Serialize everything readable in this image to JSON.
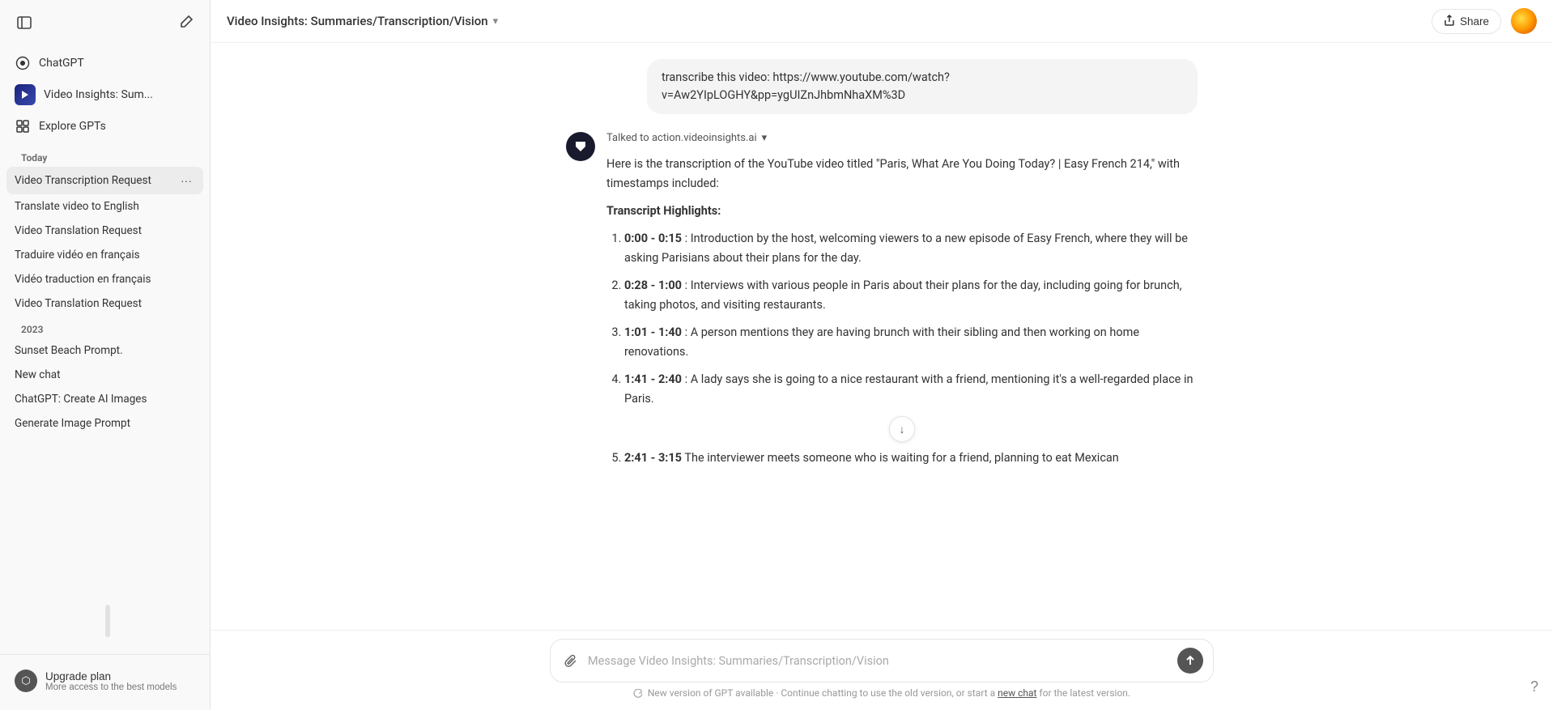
{
  "sidebar": {
    "toggle_label": "Toggle sidebar",
    "new_chat_label": "New chat",
    "nav_items": [
      {
        "id": "chatgpt",
        "label": "ChatGPT",
        "icon": "sparkle"
      },
      {
        "id": "video-insights",
        "label": "Video Insights: Sum...",
        "icon": "vi"
      },
      {
        "id": "explore-gpts",
        "label": "Explore GPTs",
        "icon": "grid"
      }
    ],
    "section_today": "Today",
    "history_today": [
      {
        "id": "video-transcription",
        "label": "Video Transcription Request",
        "active": true
      },
      {
        "id": "translate-video",
        "label": "Translate video to English"
      },
      {
        "id": "video-translation-1",
        "label": "Video Translation Request"
      },
      {
        "id": "traduire-video",
        "label": "Traduire vidéo en français"
      },
      {
        "id": "video-traduction",
        "label": "Vidéo traduction en français"
      },
      {
        "id": "video-translation-2",
        "label": "Video Translation Request"
      }
    ],
    "section_2023": "2023",
    "history_2023": [
      {
        "id": "sunset-beach",
        "label": "Sunset Beach Prompt."
      },
      {
        "id": "new-chat",
        "label": "New chat"
      },
      {
        "id": "chatgpt-ai-images",
        "label": "ChatGPT: Create AI Images"
      },
      {
        "id": "generate-image",
        "label": "Generate Image Prompt"
      }
    ],
    "upgrade": {
      "label": "Upgrade plan",
      "sublabel": "More access to the best models"
    }
  },
  "header": {
    "title": "Video Insights: Summaries/Transcription/Vision",
    "share_label": "Share",
    "share_icon": "share"
  },
  "messages": {
    "user_message": "transcribe this video: https://www.youtube.com/watch?v=Aw2YIpLOGHY&pp=ygUIZnJhbmNhaXM%3D",
    "talked_to": "Talked to action.videoinsights.ai",
    "ai_intro": "Here is the transcription of the YouTube video titled \"Paris, What Are You Doing Today? | Easy French 214,\" with timestamps included:",
    "transcript_heading": "Transcript Highlights:",
    "transcript_items": [
      {
        "timestamp": "0:00 - 0:15",
        "text": "Introduction by the host, welcoming viewers to a new episode of Easy French, where they will be asking Parisians about their plans for the day."
      },
      {
        "timestamp": "0:28 - 1:00",
        "text": "Interviews with various people in Paris about their plans for the day, including going for brunch, taking photos, and visiting restaurants."
      },
      {
        "timestamp": "1:01 - 1:40",
        "text": "A person mentions they are having brunch with their sibling and then working on home renovations."
      },
      {
        "timestamp": "1:41 - 2:40",
        "text": "A lady says she is going to a nice restaurant with a friend, mentioning it's a well-regarded place in Paris."
      },
      {
        "timestamp": "2:41 - 3:15",
        "text": "The interviewer meets someone who is waiting for a friend, planning to eat Mexican"
      }
    ]
  },
  "input": {
    "placeholder": "Message Video Insights: Summaries/Transcription/Vision",
    "attach_icon": "paperclip",
    "send_icon": "arrow-up"
  },
  "footer": {
    "notice": "New version of GPT available · Continue chatting to use the old version, or start a",
    "link_text": "new chat",
    "notice_end": "for the latest version.",
    "help_icon": "question-mark"
  }
}
